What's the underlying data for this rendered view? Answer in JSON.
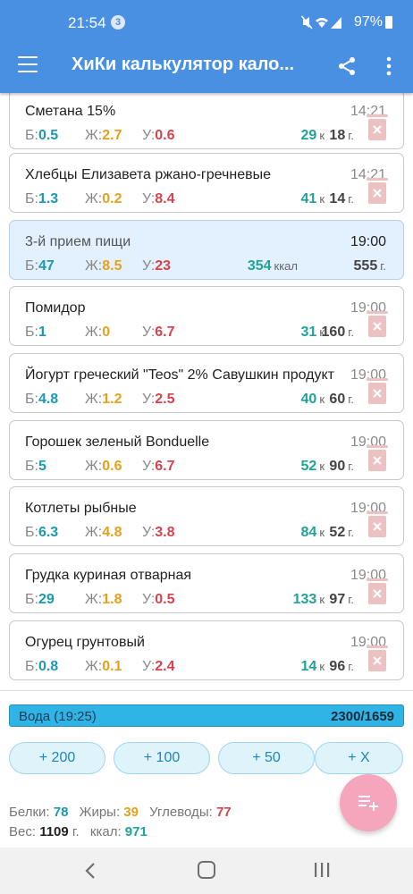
{
  "status_bar": {
    "time": "21:54",
    "notification_count": "3",
    "battery": "97%"
  },
  "app_bar": {
    "title": "ХиКи калькулятор кало..."
  },
  "labels": {
    "protein": "Б:",
    "fat": "Ж:",
    "carbs": "У:",
    "kcal_short": "к",
    "kcal_long": "ккал",
    "grams": "г."
  },
  "entries": [
    {
      "name": "Сметана 15%",
      "time": "14:21",
      "protein": "0.5",
      "fat": "2.7",
      "carbs": "0.6",
      "kcal": "29",
      "weight": "18"
    },
    {
      "name": "Хлебцы Елизавета ржано-гречневые",
      "time": "14:21",
      "protein": "1.3",
      "fat": "0.2",
      "carbs": "8.4",
      "kcal": "41",
      "weight": "14"
    },
    {
      "name": "3-й прием пищи",
      "time": "19:00",
      "protein": "47",
      "fat": "8.5",
      "carbs": "23",
      "kcal": "354",
      "weight": "555"
    },
    {
      "name": "Помидор",
      "time": "19:00",
      "protein": "1",
      "fat": "0",
      "carbs": "6.7",
      "kcal": "31",
      "weight": "160"
    },
    {
      "name": "Йогурт греческий \"Teos\" 2% Савушкин продукт",
      "time": "19:00",
      "protein": "4.8",
      "fat": "1.2",
      "carbs": "2.5",
      "kcal": "40",
      "weight": "60"
    },
    {
      "name": "Горошек зеленый Bonduelle",
      "time": "19:00",
      "protein": "5",
      "fat": "0.6",
      "carbs": "6.7",
      "kcal": "52",
      "weight": "90"
    },
    {
      "name": "Котлеты рыбные",
      "time": "19:00",
      "protein": "6.3",
      "fat": "4.8",
      "carbs": "3.8",
      "kcal": "84",
      "weight": "52"
    },
    {
      "name": "Грудка куриная отварная",
      "time": "19:00",
      "protein": "29",
      "fat": "1.8",
      "carbs": "0.5",
      "kcal": "133",
      "weight": "97"
    },
    {
      "name": "Огурец грунтовый",
      "time": "19:00",
      "protein": "0.8",
      "fat": "0.1",
      "carbs": "2.4",
      "kcal": "14",
      "weight": "96"
    }
  ],
  "water": {
    "label": "Вода (19:25)",
    "value": "2300/1659",
    "buttons": [
      "+ 200",
      "+ 100",
      "+ 50",
      "+ X"
    ]
  },
  "summary": {
    "protein_label": "Белки:",
    "protein": "78",
    "fat_label": "Жиры:",
    "fat": "39",
    "carbs_label": "Углеводы:",
    "carbs": "77",
    "weight_label": "Вес:",
    "weight": "1109",
    "weight_unit": "г.",
    "kcal_label": "ккал:",
    "kcal": "971"
  },
  "colors": {
    "primary": "#4a90e2",
    "protein": "#1a9ab0",
    "fat": "#e6a11c",
    "carbs": "#d9424a",
    "kcal": "#1fa29a",
    "meal_bg": "#e3f0fd",
    "water": "#30b4e6",
    "fab": "#f5a6bd",
    "delete": "#ecc1c1"
  },
  "icons": {
    "menu": "menu-icon",
    "share": "share-icon",
    "more": "more-vertical-icon",
    "delete": "trash-icon",
    "fab": "playlist-add-icon",
    "nav_back": "back-icon",
    "nav_home": "home-icon",
    "nav_recent": "recent-apps-icon"
  }
}
